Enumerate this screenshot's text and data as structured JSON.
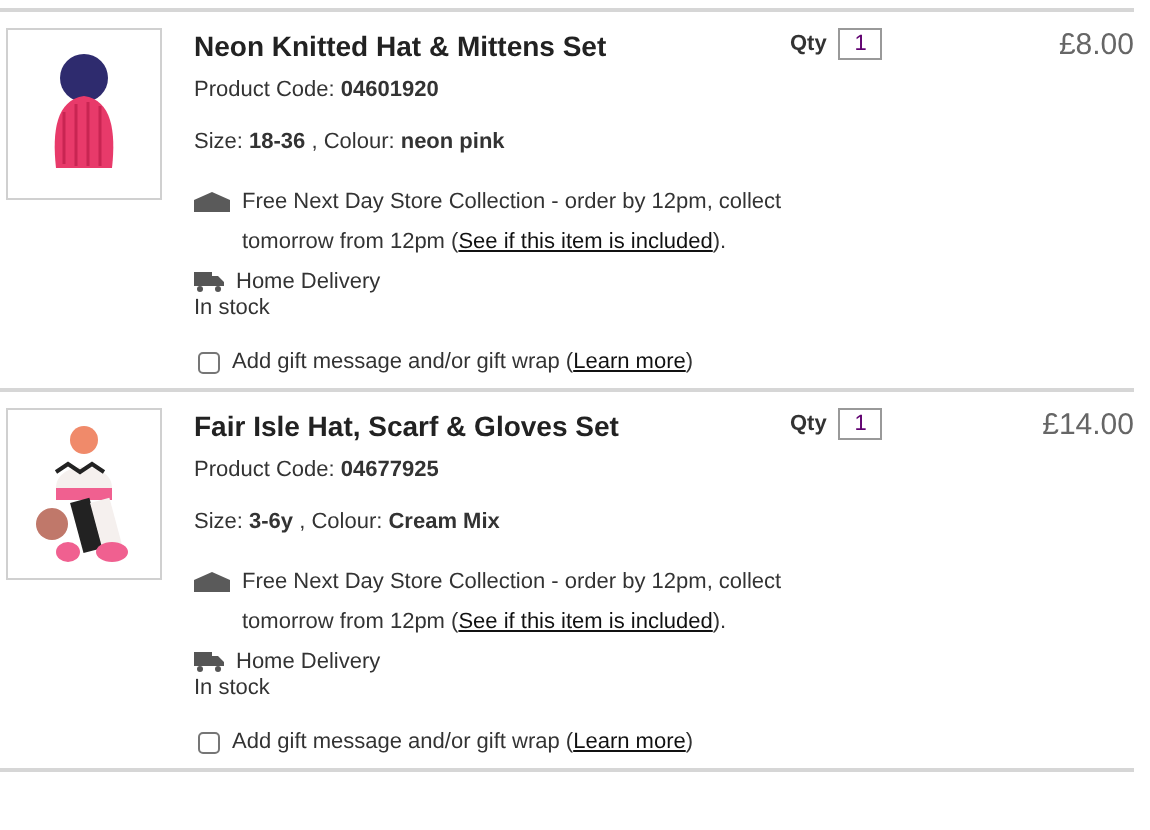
{
  "items": [
    {
      "title": "Neon Knitted Hat & Mittens Set",
      "qty_label": "Qty",
      "qty": "1",
      "price": "£8.00",
      "code": "Product Code: **04601920**",
      "attributes": "Size: **18-36** , Colour: **neon pink**",
      "collection": {
        "before": "Free Next Day Store Collection - order by 12pm, collect tomorrow from 12pm (",
        "link": "See if this item is included",
        "after": ")."
      },
      "delivery": "Home Delivery",
      "stock": "In stock",
      "gift": {
        "checked": false,
        "before": "Add gift message and/or gift wrap (",
        "link": "Learn more",
        "after": ")"
      }
    },
    {
      "title": "Fair Isle Hat, Scarf & Gloves Set",
      "qty_label": "Qty",
      "qty": "1",
      "price": "£14.00",
      "code": "Product Code: **04677925**",
      "attributes": "Size: **3-6y** , Colour: **Cream Mix**",
      "collection": {
        "before": "Free Next Day Store Collection - order by 12pm, collect tomorrow from 12pm (",
        "link": "See if this item is included",
        "after": ")."
      },
      "delivery": "Home Delivery",
      "stock": "In stock",
      "gift": {
        "checked": false,
        "before": "Add gift message and/or gift wrap (",
        "link": "Learn more",
        "after": ")"
      }
    }
  ]
}
